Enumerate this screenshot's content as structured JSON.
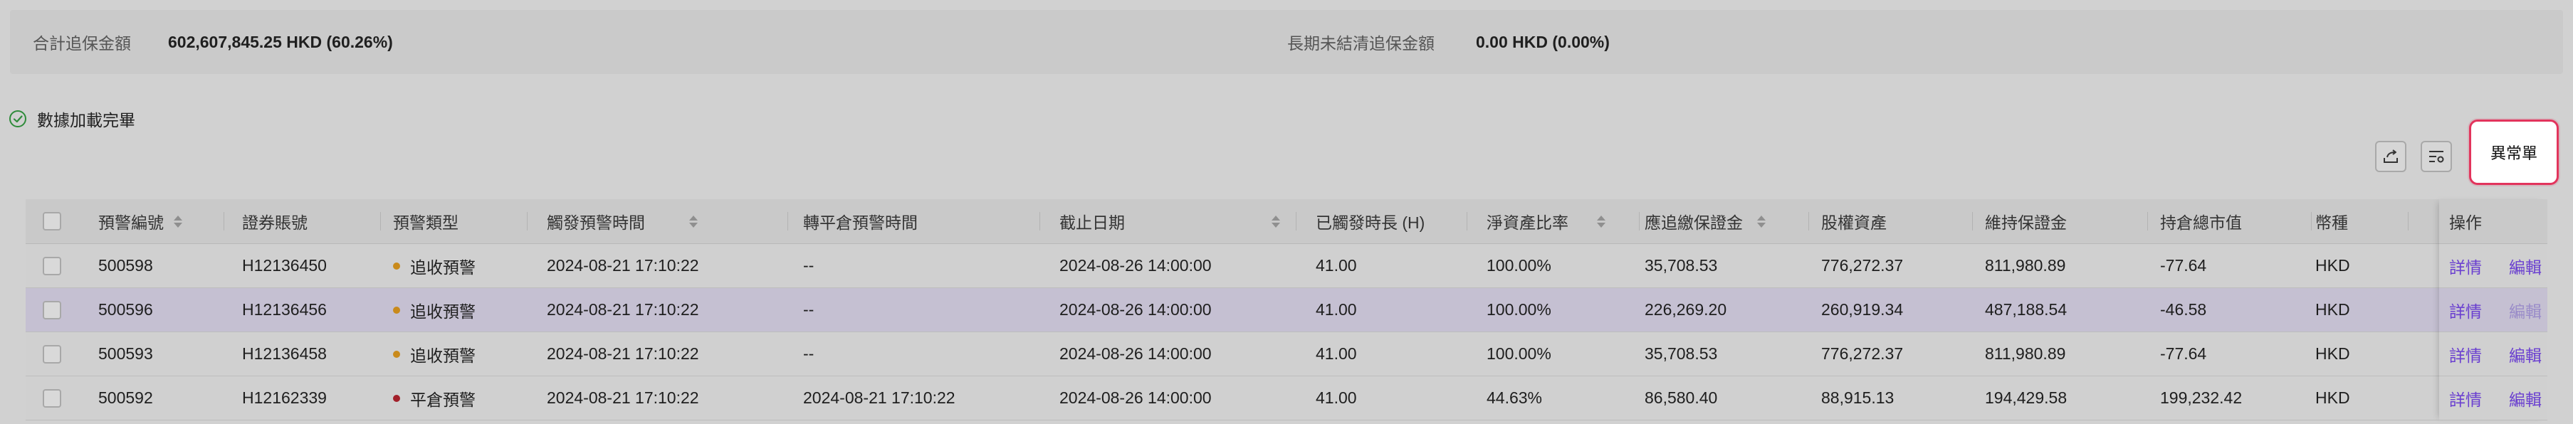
{
  "summary": {
    "total_margin_call_label": "合計追保金額",
    "total_margin_call_value": "602,607,845.25 HKD (60.26%)",
    "long_outstanding_label": "長期未結清追保金額",
    "long_outstanding_value": "0.00 HKD (0.00%)"
  },
  "status": {
    "text": "數據加載完畢"
  },
  "toolbar": {
    "abnormal_label": "異常單"
  },
  "table": {
    "headers": {
      "alert_no": "預警編號",
      "account_no": "證券賬號",
      "alert_type": "預警類型",
      "trigger_time": "觸發預警時間",
      "liquidation_time": "轉平倉預警時間",
      "deadline": "截止日期",
      "elapsed": "已觸發時長 (H)",
      "net_asset_ratio": "淨資產比率",
      "margin_due": "應追繳保證金",
      "equity": "股權資產",
      "maintenance_margin": "維持保證金",
      "market_value": "持倉總市值",
      "currency": "幣種",
      "action": "操作"
    },
    "rows": [
      {
        "alert_no": "500598",
        "account_no": "H12136450",
        "alert_type": "追收預警",
        "type_color": "#c98a1b",
        "trigger_time": "2024-08-21 17:10:22",
        "liquidation_time": "--",
        "deadline": "2024-08-26 14:00:00",
        "elapsed": "41.00",
        "net_asset_ratio": "100.00%",
        "margin_due": "35,708.53",
        "equity": "776,272.37",
        "maintenance_margin": "811,980.89",
        "market_value": "-77.64",
        "currency": "HKD",
        "detail": "詳情",
        "edit": "編輯",
        "selected": false
      },
      {
        "alert_no": "500596",
        "account_no": "H12136456",
        "alert_type": "追收預警",
        "type_color": "#c98a1b",
        "trigger_time": "2024-08-21 17:10:22",
        "liquidation_time": "--",
        "deadline": "2024-08-26 14:00:00",
        "elapsed": "41.00",
        "net_asset_ratio": "100.00%",
        "margin_due": "226,269.20",
        "equity": "260,919.34",
        "maintenance_margin": "487,188.54",
        "market_value": "-46.58",
        "currency": "HKD",
        "detail": "詳情",
        "edit": "編輯",
        "selected": true
      },
      {
        "alert_no": "500593",
        "account_no": "H12136458",
        "alert_type": "追收預警",
        "type_color": "#c98a1b",
        "trigger_time": "2024-08-21 17:10:22",
        "liquidation_time": "--",
        "deadline": "2024-08-26 14:00:00",
        "elapsed": "41.00",
        "net_asset_ratio": "100.00%",
        "margin_due": "35,708.53",
        "equity": "776,272.37",
        "maintenance_margin": "811,980.89",
        "market_value": "-77.64",
        "currency": "HKD",
        "detail": "詳情",
        "edit": "編輯",
        "selected": false
      },
      {
        "alert_no": "500592",
        "account_no": "H12162339",
        "alert_type": "平倉預警",
        "type_color": "#a2202a",
        "trigger_time": "2024-08-21 17:10:22",
        "liquidation_time": "2024-08-21 17:10:22",
        "deadline": "2024-08-26 14:00:00",
        "elapsed": "41.00",
        "net_asset_ratio": "44.63%",
        "margin_due": "86,580.40",
        "equity": "88,915.13",
        "maintenance_margin": "194,429.58",
        "market_value": "199,232.42",
        "currency": "HKD",
        "detail": "詳情",
        "edit": "編輯",
        "selected": false
      }
    ]
  },
  "colors": {
    "accent_link": "#6a3fd0",
    "highlight_border": "#e2345c",
    "warn_dot": "#c98a1b",
    "liquidation_dot": "#a2202a",
    "selected_row": "#c5c0d2"
  }
}
